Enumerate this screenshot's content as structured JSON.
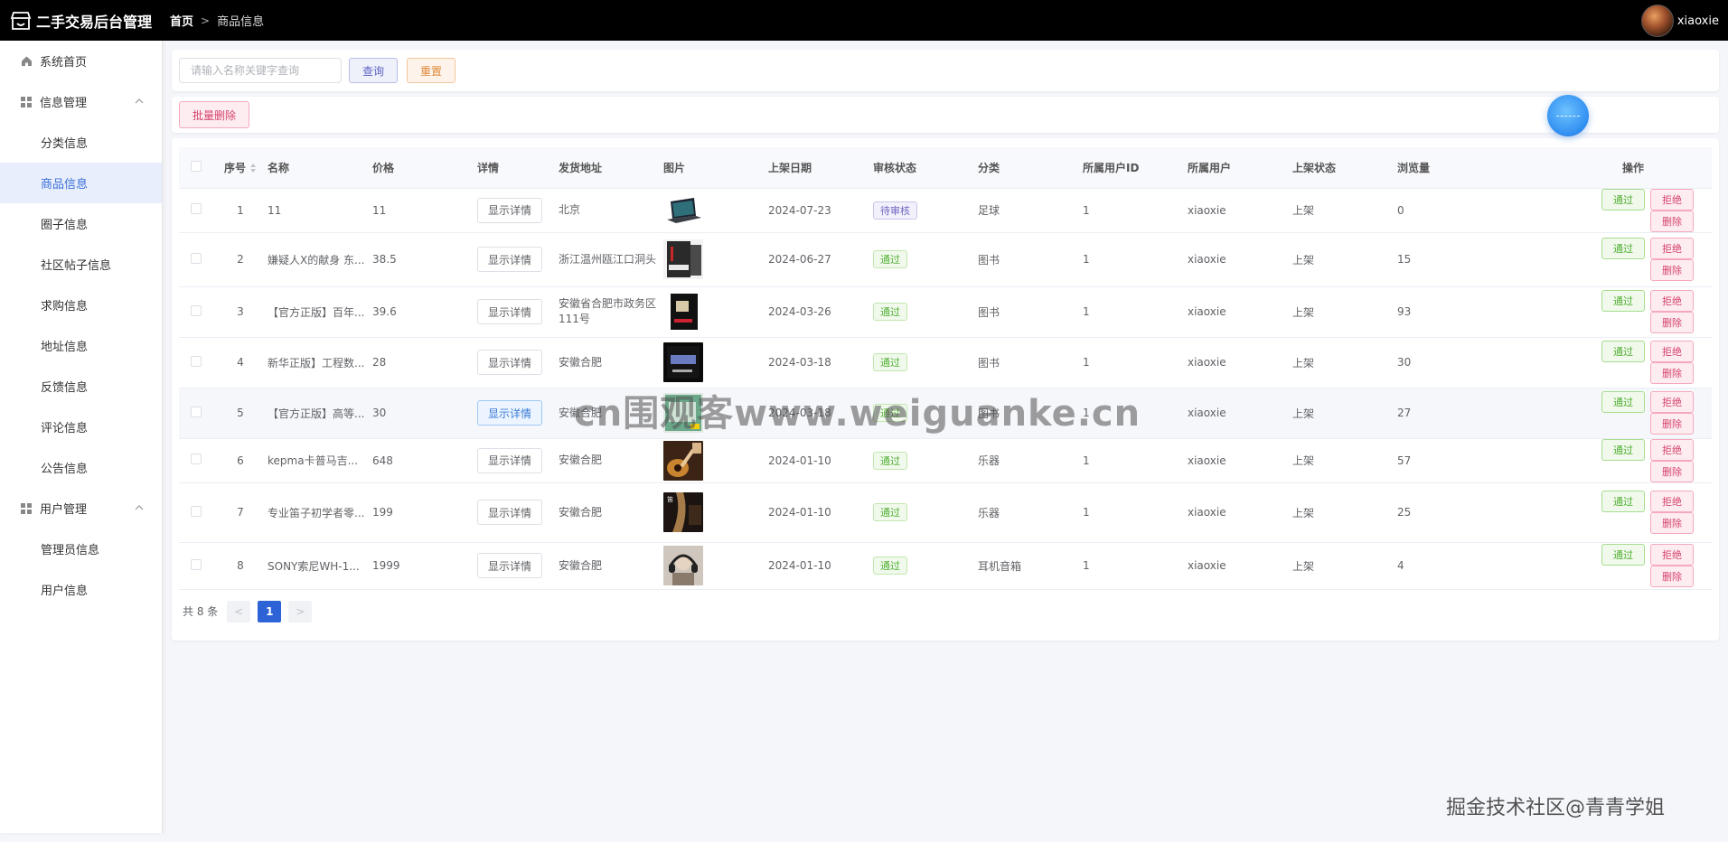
{
  "app": {
    "title": "二手交易后台管理",
    "username": "xiaoxie"
  },
  "breadcrumb": {
    "home": "首页",
    "current": "商品信息"
  },
  "sidebar": {
    "home": "系统首页",
    "group_info": "信息管理",
    "info_items": [
      "分类信息",
      "商品信息",
      "圈子信息",
      "社区帖子信息",
      "求购信息",
      "地址信息",
      "反馈信息",
      "评论信息",
      "公告信息"
    ],
    "group_user": "用户管理",
    "user_items": [
      "管理员信息",
      "用户信息"
    ]
  },
  "search": {
    "placeholder": "请输入名称关键字查询",
    "query_label": "查询",
    "reset_label": "重置"
  },
  "toolbar": {
    "batch_delete_label": "批量删除"
  },
  "table": {
    "headers": [
      "序号",
      "名称",
      "价格",
      "详情",
      "发货地址",
      "图片",
      "上架日期",
      "审核状态",
      "分类",
      "所属用户ID",
      "所属用户",
      "上架状态",
      "浏览量",
      "操作"
    ],
    "detail_label": "显示详情",
    "op_pass": "通过",
    "op_reject": "拒绝",
    "op_delete": "删除",
    "rows": [
      {
        "id": "1",
        "name": "11",
        "price": "11",
        "address": "北京",
        "date": "2024-07-23",
        "status": "待审核",
        "status_type": "pending",
        "category": "足球",
        "user_id": "1",
        "user": "xiaoxie",
        "shelf": "上架",
        "views": "0",
        "thumb": "laptop"
      },
      {
        "id": "2",
        "name": "嫌疑人X的献身 东...",
        "price": "38.5",
        "address": "浙江温州瓯江口洞头",
        "date": "2024-06-27",
        "status": "通过",
        "status_type": "pass",
        "category": "图书",
        "user_id": "1",
        "user": "xiaoxie",
        "shelf": "上架",
        "views": "15",
        "thumb": "book-dark"
      },
      {
        "id": "3",
        "name": "【官方正版】百年...",
        "price": "39.6",
        "address": "安徽省合肥市政务区111号",
        "date": "2024-03-26",
        "status": "通过",
        "status_type": "pass",
        "category": "图书",
        "user_id": "1",
        "user": "xiaoxie",
        "shelf": "上架",
        "views": "93",
        "thumb": "book-black"
      },
      {
        "id": "4",
        "name": "新华正版】工程数...",
        "price": "28",
        "address": "安徽合肥",
        "date": "2024-03-18",
        "status": "通过",
        "status_type": "pass",
        "category": "图书",
        "user_id": "1",
        "user": "xiaoxie",
        "shelf": "上架",
        "views": "30",
        "thumb": "book-blue"
      },
      {
        "id": "5",
        "name": "【官方正版】高等...",
        "price": "30",
        "address": "安徽合肥",
        "date": "2024-03-18",
        "status": "通过",
        "status_type": "pass",
        "category": "图书",
        "user_id": "1",
        "user": "xiaoxie",
        "shelf": "上架",
        "views": "27",
        "thumb": "book-green"
      },
      {
        "id": "6",
        "name": "kepma卡普马吉...",
        "price": "648",
        "address": "安徽合肥",
        "date": "2024-01-10",
        "status": "通过",
        "status_type": "pass",
        "category": "乐器",
        "user_id": "1",
        "user": "xiaoxie",
        "shelf": "上架",
        "views": "57",
        "thumb": "guitar"
      },
      {
        "id": "7",
        "name": "专业笛子初学者零...",
        "price": "199",
        "address": "安徽合肥",
        "date": "2024-01-10",
        "status": "通过",
        "status_type": "pass",
        "category": "乐器",
        "user_id": "1",
        "user": "xiaoxie",
        "shelf": "上架",
        "views": "25",
        "thumb": "flute"
      },
      {
        "id": "8",
        "name": "SONY索尼WH-1...",
        "price": "1999",
        "address": "安徽合肥",
        "date": "2024-01-10",
        "status": "通过",
        "status_type": "pass",
        "category": "耳机音箱",
        "user_id": "1",
        "user": "xiaoxie",
        "shelf": "上架",
        "views": "4",
        "thumb": "headphone"
      }
    ]
  },
  "pager": {
    "total": "共 8 条",
    "current": "1"
  },
  "watermarks": {
    "center": "cn围观客www.weiguanke.cn",
    "corner": "掘金技术社区@青青学姐"
  }
}
